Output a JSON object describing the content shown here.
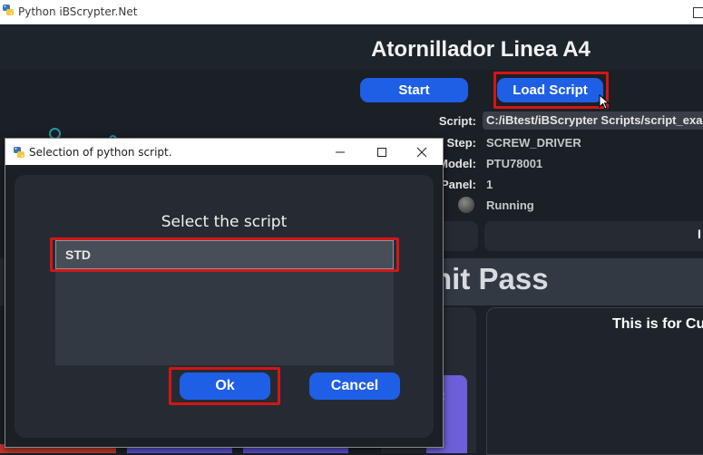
{
  "window": {
    "title": "Python iBScrypter.Net"
  },
  "app": {
    "title": "Atornillador Linea A4",
    "start_label": "Start",
    "load_script_label": "Load Script",
    "info": {
      "script_label": "Script:",
      "script_value": "C:/iBtest/iBScrypter Scripts/script_exa",
      "step_label": "Step:",
      "step_value": "SCREW_DRIVER",
      "model_label": "Model:",
      "model_value": "PTU78001",
      "panel_label": "Panel:",
      "panel_value": "1",
      "status_value": "Running"
    },
    "pass_banner": "nit Pass",
    "cu_text": "This is for Cu",
    "tile_text": ":"
  },
  "dialog": {
    "title": "Selection of python script.",
    "heading": "Select the script",
    "items": [
      "STD"
    ],
    "ok_label": "Ok",
    "cancel_label": "Cancel"
  },
  "colors": {
    "accent_blue": "#1f5fe6",
    "highlight_red": "#d21616",
    "background": "#1b1f26",
    "purple_tile": "#6d5fd9"
  }
}
